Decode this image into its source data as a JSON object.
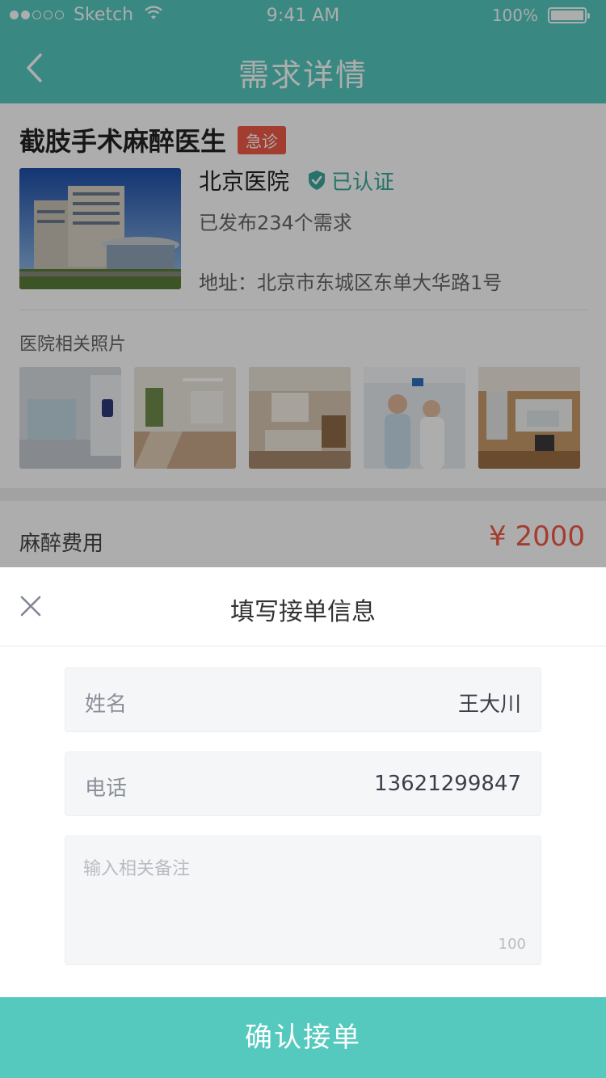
{
  "status_bar": {
    "carrier": "Sketch",
    "time": "9:41 AM",
    "battery": "100%",
    "battery_level": 1.0
  },
  "nav": {
    "title": "需求详情",
    "back_icon": "chevron-left-icon"
  },
  "demand": {
    "title": "截肢手术麻醉医生",
    "urgent_label": "急诊"
  },
  "hospital": {
    "name": "北京医院",
    "verified_label": "已认证",
    "published": "已发布234个需求",
    "address": "地址：北京市东城区东单大华路1号"
  },
  "photos": {
    "label": "医院相关照片",
    "count": 5
  },
  "fee": {
    "label": "麻醉费用",
    "value": "¥ 2000"
  },
  "sheet": {
    "title": "填写接单信息",
    "name_label": "姓名",
    "name_value": "王大川",
    "phone_label": "电话",
    "phone_value": "13621299847",
    "notes_placeholder": "输入相关备注",
    "notes_max": "100",
    "confirm_label": "确认接单"
  },
  "colors": {
    "primary": "#55c9be",
    "accent_red": "#f05b47",
    "verified_green": "#3aa89d"
  }
}
